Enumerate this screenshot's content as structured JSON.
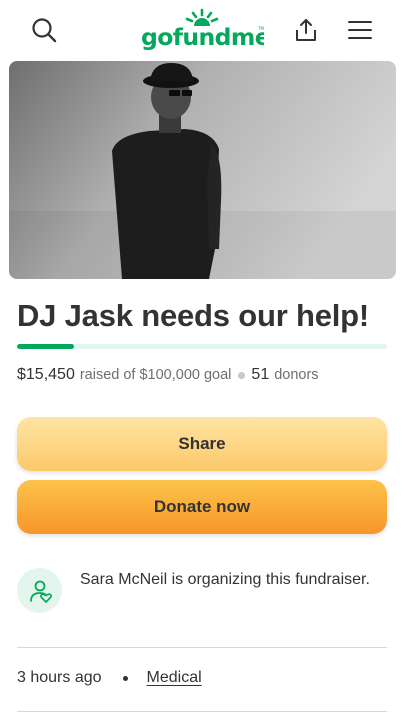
{
  "header": {
    "logo_text": "gofundme",
    "brand_color": "#02a95c"
  },
  "campaign": {
    "title": "DJ Jask needs our help!",
    "raised": "$15,450",
    "raised_of_goal_text": "raised of $100,000 goal",
    "donor_count": "51",
    "donors_label": "donors",
    "progress_fraction": 0.1545
  },
  "actions": {
    "share_label": "Share",
    "donate_label": "Donate now"
  },
  "organizer": {
    "text": "Sara McNeil is organizing this fundraiser."
  },
  "meta": {
    "time_ago": "3 hours ago",
    "category": "Medical"
  },
  "icons": {
    "search": "search-icon",
    "share": "share-upload-icon",
    "menu": "hamburger-menu-icon",
    "organizer": "person-heart-icon"
  }
}
